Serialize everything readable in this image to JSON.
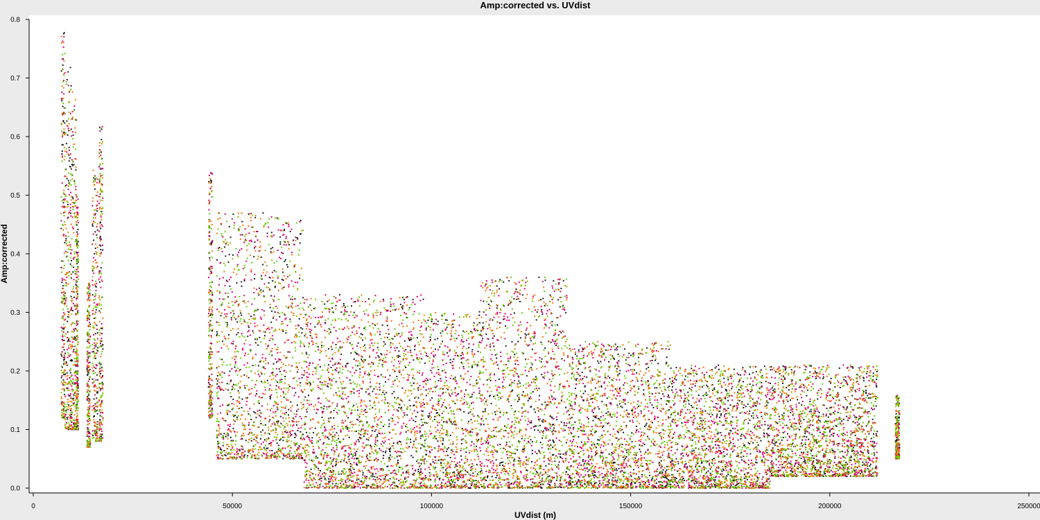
{
  "chart_data": {
    "type": "scatter",
    "title": "Amp:corrected vs. UVdist",
    "xlabel": "UVdist (m)",
    "ylabel": "Amp:corrected",
    "xlim": [
      0,
      250000
    ],
    "ylim": [
      0,
      0.8
    ],
    "x_ticks": [
      "0",
      "50000",
      "100000",
      "150000",
      "200000",
      "250000"
    ],
    "y_ticks": [
      "0.0",
      "0.1",
      "0.2",
      "0.3",
      "0.4",
      "0.5",
      "0.6",
      "0.7",
      "0.8"
    ],
    "grid": false,
    "legend": "none",
    "series": [
      {
        "color": "#1a1a1a"
      },
      {
        "color": "#e0006e"
      },
      {
        "color": "#f07800"
      },
      {
        "color": "#66cc00"
      }
    ],
    "clusters": [
      {
        "x": [
          7000,
          8000
        ],
        "y": [
          0.12,
          0.78
        ]
      },
      {
        "x": [
          8000,
          9500
        ],
        "y": [
          0.1,
          0.72
        ]
      },
      {
        "x": [
          9500,
          10800
        ],
        "y": [
          0.1,
          0.68
        ]
      },
      {
        "x": [
          10800,
          11300
        ],
        "y": [
          0.1,
          0.5
        ]
      },
      {
        "x": [
          13500,
          14300
        ],
        "y": [
          0.07,
          0.35
        ]
      },
      {
        "x": [
          14800,
          16200
        ],
        "y": [
          0.08,
          0.55
        ]
      },
      {
        "x": [
          16500,
          17500
        ],
        "y": [
          0.08,
          0.62
        ]
      },
      {
        "x": [
          44000,
          45000
        ],
        "y": [
          0.12,
          0.54
        ]
      },
      {
        "x": [
          46000,
          62000
        ],
        "y": [
          0.05,
          0.47
        ]
      },
      {
        "x": [
          62000,
          68000
        ],
        "y": [
          0.05,
          0.46
        ]
      },
      {
        "x": [
          68000,
          98000
        ],
        "y": [
          0.0,
          0.33
        ]
      },
      {
        "x": [
          98000,
          112000
        ],
        "y": [
          0.0,
          0.3
        ]
      },
      {
        "x": [
          112000,
          134000
        ],
        "y": [
          0.0,
          0.36
        ]
      },
      {
        "x": [
          134000,
          160000
        ],
        "y": [
          0.0,
          0.25
        ]
      },
      {
        "x": [
          160000,
          185000
        ],
        "y": [
          0.0,
          0.21
        ]
      },
      {
        "x": [
          185000,
          212000
        ],
        "y": [
          0.02,
          0.21
        ]
      },
      {
        "x": [
          216500,
          217500
        ],
        "y": [
          0.05,
          0.16
        ]
      }
    ]
  }
}
